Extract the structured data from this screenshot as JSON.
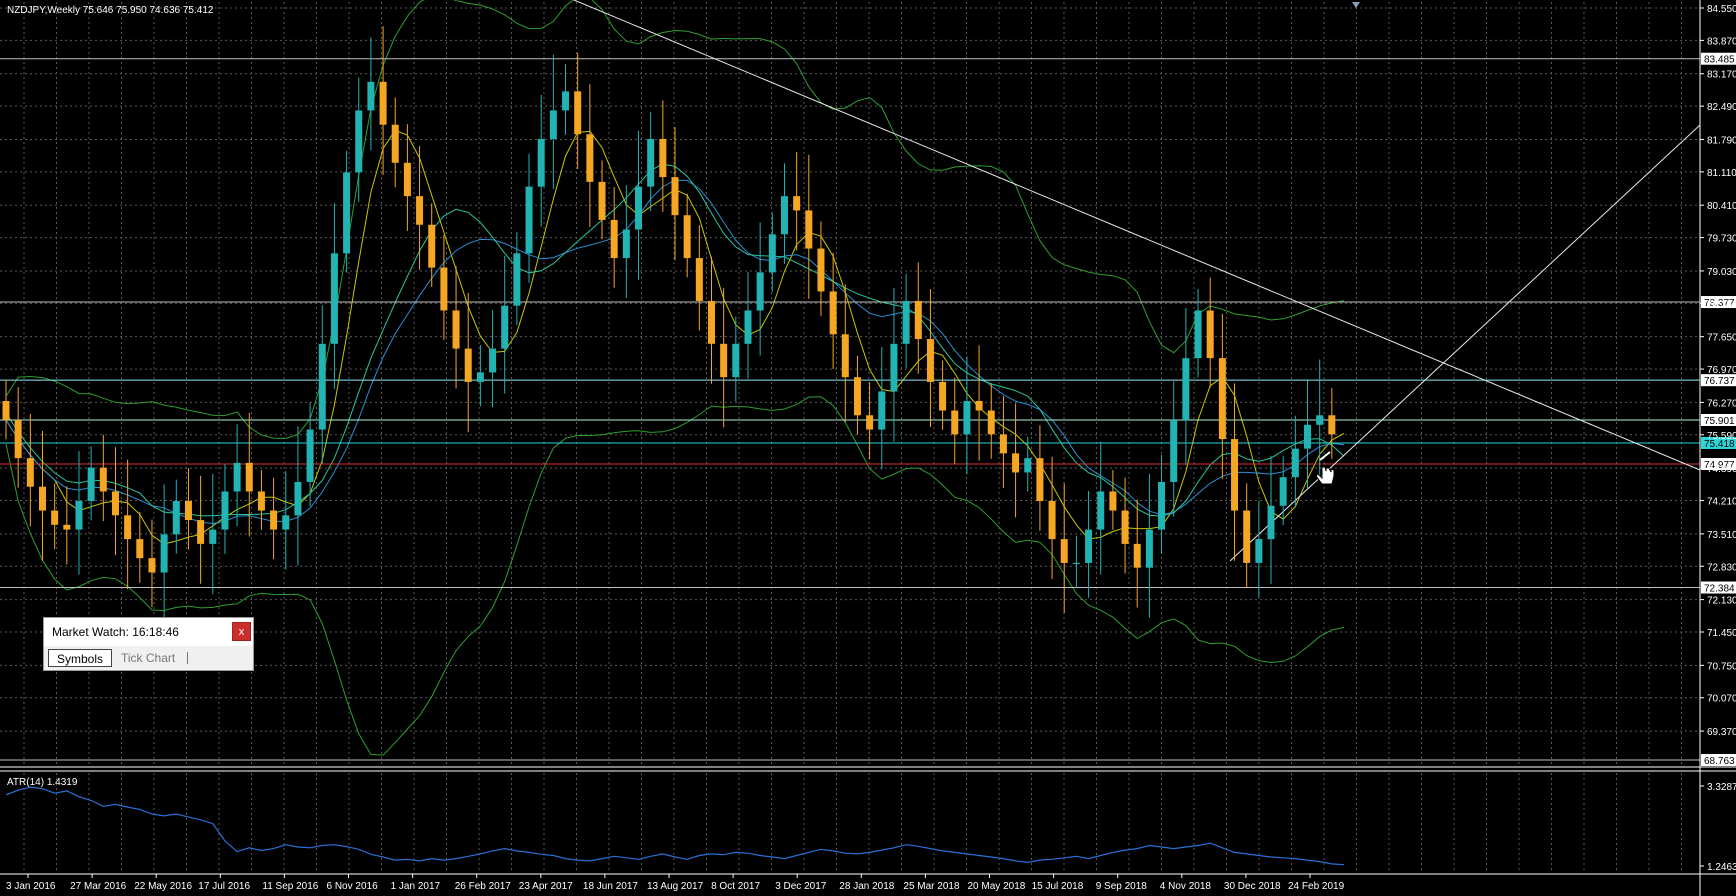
{
  "window": {
    "title": "NZDJPY,Weekly  75.646 75.950 74.636 75.412",
    "indicator_label": "ATR(14) 1.4319"
  },
  "colors": {
    "background": "#000000",
    "grid": "#5a5a5a",
    "bull_candle": "#22b3b3",
    "bear_candle": "#f5a623",
    "ma_fast": "#c8c800",
    "ma_slow": "#2a8fd6",
    "ma_mid": "#2ac6a0",
    "bollinger": "#2e9e2e",
    "atr_line": "#2a6fd6",
    "current_price": "#2ad6d6",
    "support_red": "#e03030"
  },
  "price_axis": {
    "ticks": [
      "84.550",
      "83.870",
      "83.170",
      "82.490",
      "81.790",
      "81.110",
      "80.410",
      "79.730",
      "79.030",
      "78.350",
      "77.650",
      "76.970",
      "76.270",
      "75.590",
      "74.890",
      "74.210",
      "73.510",
      "72.830",
      "72.130",
      "71.450",
      "70.750",
      "70.070",
      "69.370"
    ],
    "max": 84.55,
    "min": 68.763
  },
  "atr_axis": {
    "ticks": [
      "3.3287",
      "1.2463"
    ],
    "max": 3.3287,
    "min": 1.2463
  },
  "time_axis": {
    "labels": [
      "3 Jan 2016",
      "27 Mar 2016",
      "22 May 2016",
      "17 Jul 2016",
      "11 Sep 2016",
      "6 Nov 2016",
      "1 Jan 2017",
      "26 Feb 2017",
      "23 Apr 2017",
      "18 Jun 2017",
      "13 Aug 2017",
      "8 Oct 2017",
      "3 Dec 2017",
      "28 Jan 2018",
      "25 Mar 2018",
      "20 May 2018",
      "15 Jul 2018",
      "9 Sep 2018",
      "4 Nov 2018",
      "30 Dec 2018",
      "24 Feb 2019"
    ]
  },
  "horizontal_levels": [
    {
      "label": "83.485",
      "price": 83.485,
      "color": "#c0c0c0",
      "box_bg": "#ffffff",
      "box_fg": "#000000"
    },
    {
      "label": "78.377",
      "price": 78.377,
      "color": "#c0c0c0",
      "box_bg": "#ffffff",
      "box_fg": "#000000"
    },
    {
      "label": "76.737",
      "price": 76.737,
      "color": "#8fe8f8",
      "box_bg": "#ffffff",
      "box_fg": "#000000"
    },
    {
      "label": "75.901",
      "price": 75.901,
      "color": "#aaf5d8",
      "box_bg": "#ffffff",
      "box_fg": "#000000"
    },
    {
      "label": "75.418",
      "price": 75.418,
      "color": "#2ad6d6",
      "box_bg": "#2ad6d6",
      "box_fg": "#000000"
    },
    {
      "label": "74.977",
      "price": 74.977,
      "color": "#e03030",
      "box_bg": "#ffffff",
      "box_fg": "#000000"
    },
    {
      "label": "72.384",
      "price": 72.384,
      "color": "#c0c0c0",
      "box_bg": "#ffffff",
      "box_fg": "#000000"
    },
    {
      "label": "68.763",
      "price": 68.763,
      "color": "#c0c0c0",
      "box_bg": "#ffffff",
      "box_fg": "#000000"
    }
  ],
  "market_watch": {
    "title": "Market Watch: 16:18:46",
    "close_label": "x",
    "tabs": [
      {
        "label": "Symbols",
        "active": true
      },
      {
        "label": "Tick Chart",
        "active": false
      }
    ]
  },
  "chart_data": {
    "type": "candlestick",
    "symbol": "NZDJPY",
    "timeframe": "Weekly",
    "last_bar": {
      "open": 75.646,
      "high": 75.95,
      "low": 74.636,
      "close": 75.412
    },
    "close_path": [
      75.9,
      75.1,
      74.5,
      74.0,
      73.7,
      73.6,
      74.2,
      74.9,
      74.4,
      73.9,
      73.4,
      73.0,
      72.7,
      73.5,
      74.2,
      73.8,
      73.3,
      73.6,
      74.4,
      75.0,
      74.4,
      74.0,
      73.6,
      73.9,
      74.6,
      75.7,
      77.5,
      79.4,
      81.1,
      82.4,
      83.0,
      82.1,
      81.3,
      80.6,
      80.0,
      79.1,
      78.2,
      77.4,
      76.7,
      76.9,
      77.4,
      78.3,
      79.4,
      80.8,
      81.8,
      82.4,
      82.8,
      81.9,
      80.9,
      80.1,
      79.3,
      79.9,
      80.8,
      81.8,
      81.0,
      80.2,
      79.3,
      78.4,
      77.5,
      76.8,
      77.5,
      78.2,
      79.0,
      79.8,
      80.6,
      80.3,
      79.5,
      78.6,
      77.7,
      76.8,
      76.0,
      75.7,
      76.5,
      77.5,
      78.4,
      77.6,
      76.7,
      76.1,
      75.6,
      76.3,
      76.1,
      75.6,
      75.2,
      74.8,
      75.1,
      74.2,
      73.4,
      72.9,
      72.9,
      73.6,
      74.4,
      74.0,
      73.3,
      72.8,
      73.6,
      74.6,
      75.9,
      77.2,
      78.2,
      77.2,
      75.5,
      74.0,
      72.9,
      73.4,
      74.1,
      74.7,
      75.3,
      75.8,
      76.0,
      75.6,
      75.4
    ],
    "atr_path": [
      3.1,
      3.22,
      3.3,
      3.26,
      3.14,
      3.2,
      3.05,
      2.95,
      2.8,
      2.85,
      2.78,
      2.72,
      2.6,
      2.55,
      2.6,
      2.52,
      2.45,
      2.35,
      1.9,
      1.62,
      1.72,
      1.65,
      1.7,
      1.8,
      1.74,
      1.72,
      1.78,
      1.8,
      1.75,
      1.68,
      1.55,
      1.48,
      1.4,
      1.42,
      1.38,
      1.44,
      1.4,
      1.44,
      1.5,
      1.56,
      1.64,
      1.7,
      1.64,
      1.6,
      1.55,
      1.52,
      1.44,
      1.4,
      1.38,
      1.44,
      1.5,
      1.46,
      1.42,
      1.5,
      1.56,
      1.48,
      1.42,
      1.52,
      1.56,
      1.54,
      1.6,
      1.58,
      1.52,
      1.48,
      1.44,
      1.52,
      1.6,
      1.68,
      1.64,
      1.58,
      1.56,
      1.6,
      1.66,
      1.72,
      1.8,
      1.76,
      1.7,
      1.64,
      1.6,
      1.56,
      1.52,
      1.48,
      1.44,
      1.38,
      1.34,
      1.4,
      1.42,
      1.46,
      1.5,
      1.44,
      1.52,
      1.6,
      1.66,
      1.7,
      1.78,
      1.74,
      1.7,
      1.74,
      1.78,
      1.84,
      1.72,
      1.6,
      1.56,
      1.52,
      1.48,
      1.46,
      1.44,
      1.4,
      1.36,
      1.3,
      1.28
    ]
  }
}
